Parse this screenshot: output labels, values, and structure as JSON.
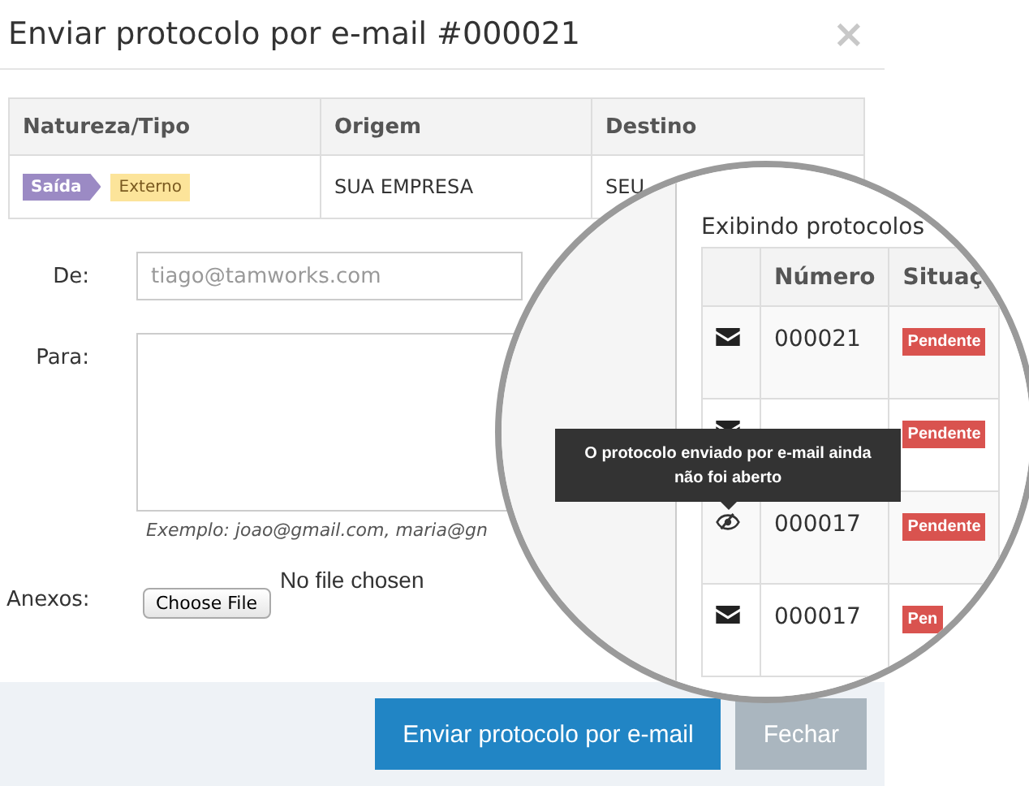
{
  "dialog": {
    "title": "Enviar protocolo por e-mail #000021",
    "close": "×"
  },
  "summary_table": {
    "columns": [
      "Natureza/Tipo",
      "Origem",
      "Destino"
    ],
    "rows": [
      {
        "cells": [
          {
            "kind": "tags",
            "tags": [
              {
                "label": "Saída",
                "color": "#9b8ac4",
                "kind": "arrow"
              },
              {
                "label": "Externo",
                "color": "#fce49a",
                "kind": "plain"
              }
            ]
          },
          {
            "kind": "text",
            "text": "SUA EMPRESA"
          },
          {
            "kind": "text",
            "text": "SEU"
          }
        ]
      }
    ]
  },
  "form": {
    "from": {
      "label": "De:",
      "placeholder": "tiago@tamworks.com"
    },
    "to": {
      "label": "Para:",
      "hint": "Exemplo: joao@gmail.com, maria@gn"
    },
    "attachments": {
      "label": "Anexos:",
      "button": "Choose File",
      "status": "No file chosen"
    }
  },
  "buttons": [
    {
      "label": "Enviar protocolo por e-mail",
      "kind": "primary"
    },
    {
      "label": "Fechar",
      "kind": "secondary"
    }
  ],
  "magnifier": {
    "caption": "Exibindo protocolos",
    "columns": [
      "Número",
      "Situaç"
    ],
    "rows": [
      {
        "kind": "envelope",
        "number": "000021",
        "status": "Pendente"
      },
      {
        "kind": "envelope",
        "status": "Pendente"
      },
      {
        "kind": "eye-slash",
        "number": "000017",
        "status": "Pendente"
      },
      {
        "kind": "envelope",
        "number": "000017",
        "status": "Pen"
      }
    ],
    "tooltip": "O protocolo enviado por e-mail ainda não foi aberto"
  }
}
